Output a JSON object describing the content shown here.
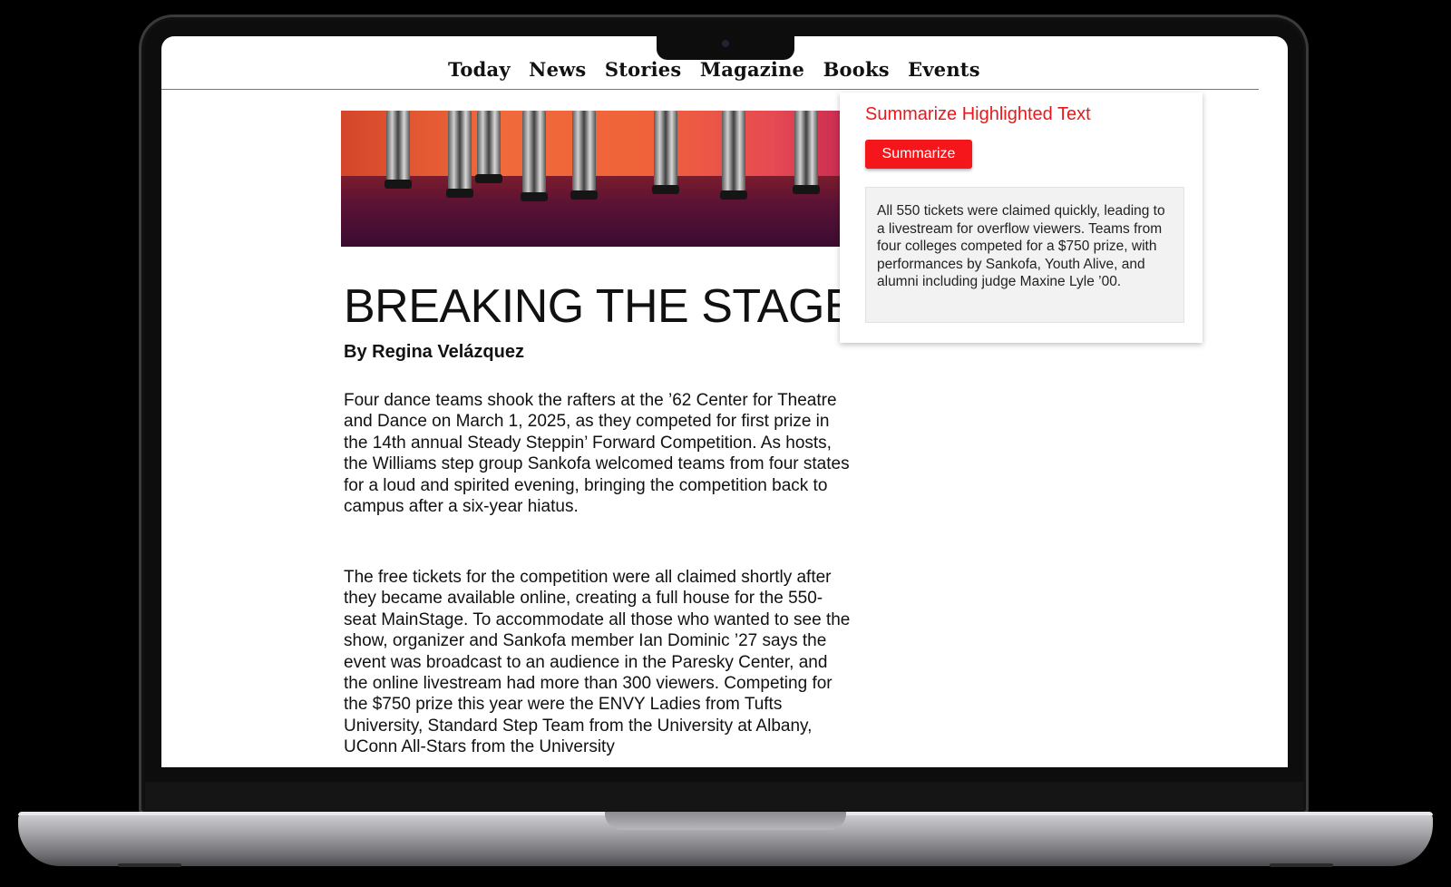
{
  "nav": {
    "items": [
      "Today",
      "News",
      "Stories",
      "Magazine",
      "Books",
      "Events"
    ]
  },
  "article": {
    "title": "BREAKING THE STAGE",
    "byline": "By Regina Velázquez",
    "paragraphs": [
      "Four dance teams shook the rafters at the ’62 Center for Theatre and Dance on March 1, 2025, as they competed for first prize in the 14th annual Steady Steppin’ Forward Competition. As hosts, the Williams step group Sankofa welcomed teams from four states for a loud and spirited evening, bringing the competition back to campus after a six-year hiatus.",
      "The free tickets for the competition were all claimed shortly after they became available online, creating a full house for the 550-seat MainStage. To accommodate all those who wanted to see the show, organizer and Sankofa member Ian Dominic ’27 says the event was broadcast to an audience in the Paresky Center, and the online livestream had more than 300 viewers. Competing for the $750 prize this year were the ENVY Ladies from Tufts University, Standard Step Team from the University at Albany, UConn All-Stars from the University"
    ]
  },
  "summarizer": {
    "title": "Summarize Highlighted Text",
    "button_label": "Summarize",
    "summary": "All 550 tickets were claimed quickly, leading to a livestream for overflow viewers. Teams from four colleges competed for a $750 prize, with performances by Sankofa, Youth Alive, and alumni including judge Maxine Lyle ’00."
  },
  "colors": {
    "accent": "#f5161b",
    "panel_title": "#e8191d"
  }
}
